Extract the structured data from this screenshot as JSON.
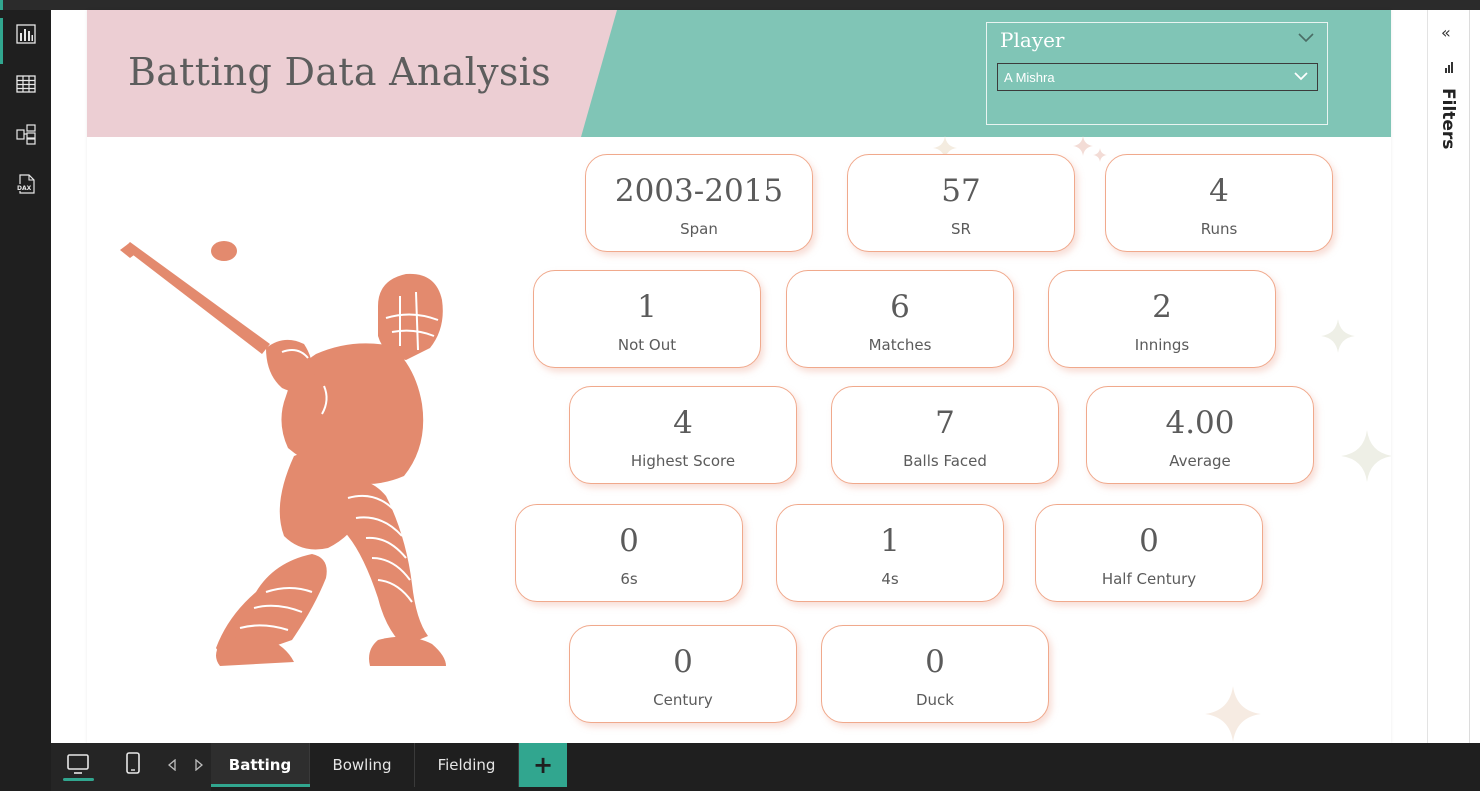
{
  "report": {
    "title": "Batting Data Analysis"
  },
  "slicer": {
    "title": "Player",
    "selected": "A Mishra"
  },
  "kpis": [
    {
      "value": "2003-2015",
      "label": "Span"
    },
    {
      "value": "57",
      "label": "SR"
    },
    {
      "value": "4",
      "label": "Runs"
    },
    {
      "value": "1",
      "label": "Not Out"
    },
    {
      "value": "6",
      "label": "Matches"
    },
    {
      "value": "2",
      "label": "Innings"
    },
    {
      "value": "4",
      "label": "Highest Score"
    },
    {
      "value": "7",
      "label": "Balls Faced"
    },
    {
      "value": "4.00",
      "label": "Average"
    },
    {
      "value": "0",
      "label": "6s"
    },
    {
      "value": "1",
      "label": "4s"
    },
    {
      "value": "0",
      "label": "Half Century"
    },
    {
      "value": "0",
      "label": "Century"
    },
    {
      "value": "0",
      "label": "Duck"
    }
  ],
  "filters_pane": {
    "label": "Filters",
    "collapse_glyph": "«"
  },
  "tabs": {
    "pages": [
      "Batting",
      "Bowling",
      "Fielding"
    ],
    "active": "Batting",
    "add_label": "+"
  },
  "icons": {
    "left_rail": [
      "report-view-icon",
      "table-view-icon",
      "model-view-icon",
      "dax-query-icon"
    ],
    "bottom": [
      "desktop-layout-icon",
      "mobile-layout-icon",
      "prev-page-icon",
      "next-page-icon"
    ]
  },
  "colors": {
    "accent": "#31a68f",
    "header_pink": "#ecced3",
    "header_teal": "#80c5b6",
    "card_border": "#f0a98c",
    "illustration": "#e38a6e"
  }
}
